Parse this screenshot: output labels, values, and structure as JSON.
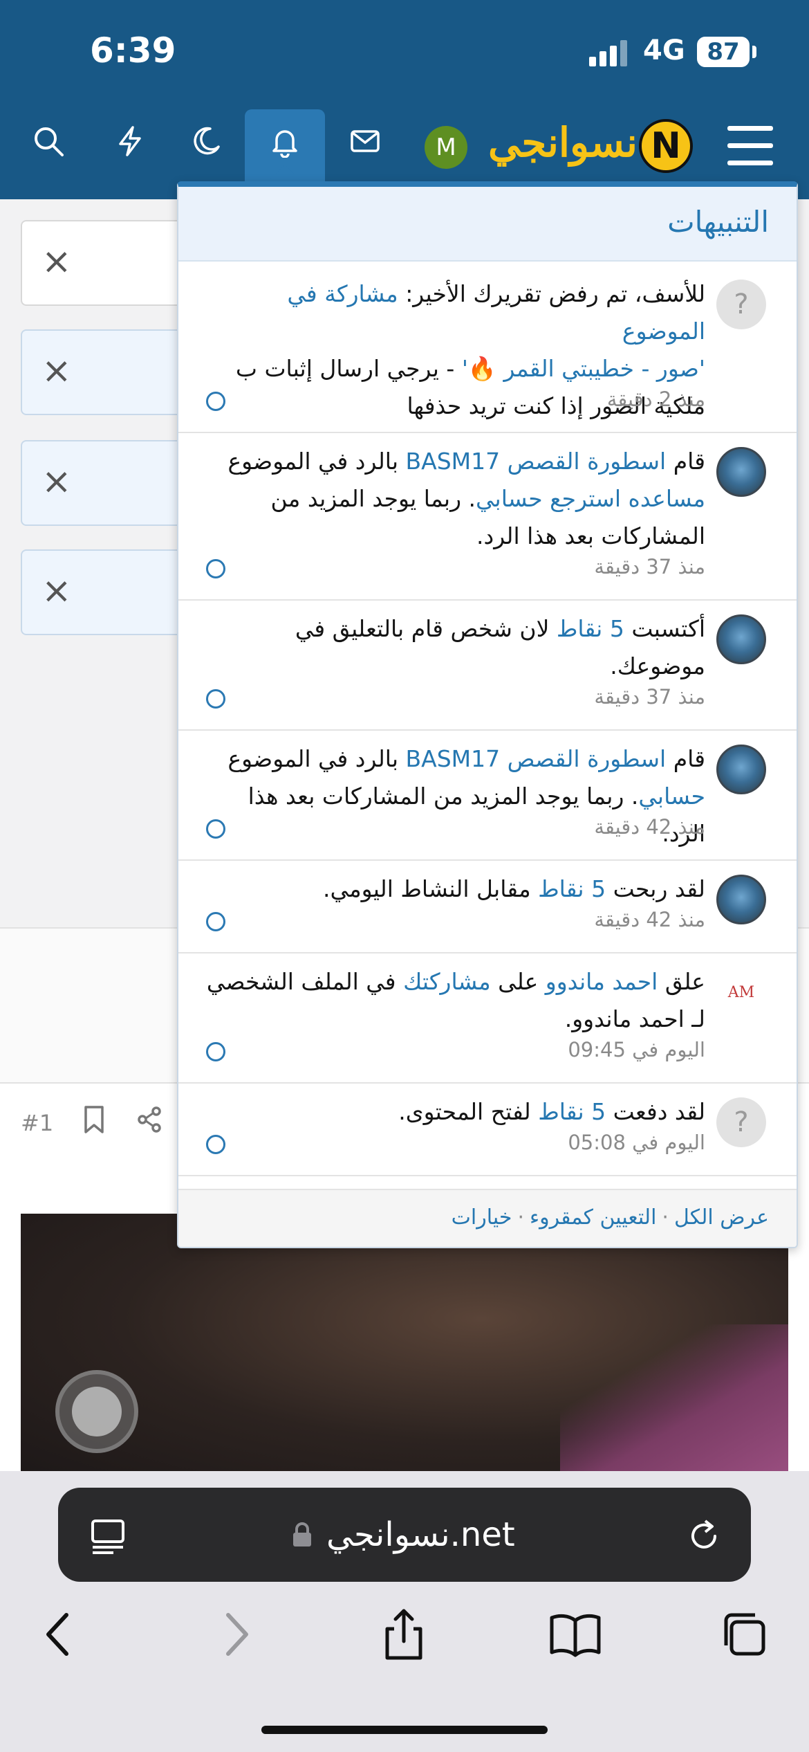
{
  "status_bar": {
    "time": "6:39",
    "network": "4G",
    "battery": "87"
  },
  "header": {
    "logo_text": "نسوانجي",
    "logo_letter": "N",
    "avatar_letter": "M",
    "icons": [
      "menu-icon",
      "bell-icon",
      "mail-icon",
      "moon-icon",
      "lightning-icon",
      "search-icon"
    ]
  },
  "notifications": {
    "title": "التنبيهات",
    "items": [
      {
        "avatar": "question-avatar",
        "lines": [
          {
            "parts": [
              {
                "t": "للأسف، تم رفض تقريرك الأخير: ",
                "link": false
              },
              {
                "t": "مشاركة في الموضوع",
                "link": true
              }
            ]
          },
          {
            "parts": [
              {
                "t": "'صور - خطيبتي القمر 🔥'",
                "link": true
              },
              {
                "t": " - يرجي ارسال إثبات ب",
                "link": false
              }
            ]
          },
          {
            "parts": [
              {
                "t": "ملكية الصور إذا كنت تريد حذفها",
                "link": false
              }
            ]
          }
        ],
        "time": "منذ 2 دقيقة"
      },
      {
        "avatar": "user-photo-avatar",
        "lines": [
          {
            "parts": [
              {
                "t": "قام ",
                "link": false
              },
              {
                "t": "اسطورة القصص BASM17",
                "link": true
              },
              {
                "t": " بالرد في الموضوع",
                "link": false
              }
            ]
          },
          {
            "parts": [
              {
                "t": "مساعده استرجع حسابي",
                "link": true
              },
              {
                "t": ". ربما يوجد المزيد من",
                "link": false
              }
            ]
          },
          {
            "parts": [
              {
                "t": "المشاركات بعد هذا الرد.",
                "link": false
              }
            ]
          }
        ],
        "time": "منذ 37 دقيقة"
      },
      {
        "avatar": "user-photo-avatar",
        "lines": [
          {
            "parts": [
              {
                "t": "أكتسبت ",
                "link": false
              },
              {
                "t": "5 نقاط",
                "link": true
              },
              {
                "t": " لان شخص قام بالتعليق في",
                "link": false
              }
            ]
          },
          {
            "parts": [
              {
                "t": "موضوعك.",
                "link": false
              }
            ]
          }
        ],
        "time": "منذ 37 دقيقة"
      },
      {
        "avatar": "user-photo-avatar",
        "lines": [
          {
            "parts": [
              {
                "t": "قام ",
                "link": false
              },
              {
                "t": "اسطورة القصص BASM17",
                "link": true
              },
              {
                "t": " بالرد في الموضوع",
                "link": false
              }
            ]
          },
          {
            "parts": [
              {
                "t": "حسابي",
                "link": true
              },
              {
                "t": ". ربما يوجد المزيد من المشاركات بعد هذا الرد.",
                "link": false
              }
            ]
          }
        ],
        "time": "منذ 42 دقيقة"
      },
      {
        "avatar": "user-photo-avatar",
        "lines": [
          {
            "parts": [
              {
                "t": "لقد ربحت ",
                "link": false
              },
              {
                "t": "5 نقاط",
                "link": true
              },
              {
                "t": " مقابل النشاط اليومي.",
                "link": false
              }
            ]
          }
        ],
        "time": "منذ 42 دقيقة"
      },
      {
        "avatar": "am-logo-avatar",
        "avatar_text": "AM",
        "lines": [
          {
            "parts": [
              {
                "t": "علق ",
                "link": false
              },
              {
                "t": "احمد ماندوو",
                "link": true
              },
              {
                "t": " على ",
                "link": false
              },
              {
                "t": "مشاركتك",
                "link": true
              },
              {
                "t": " في الملف الشخصي",
                "link": false
              }
            ]
          },
          {
            "parts": [
              {
                "t": "لـ احمد ماندوو.",
                "link": false
              }
            ]
          }
        ],
        "time": "اليوم في 09:45"
      },
      {
        "avatar": "question-avatar",
        "lines": [
          {
            "parts": [
              {
                "t": "لقد دفعت ",
                "link": false
              },
              {
                "t": "5 نقاط",
                "link": true
              },
              {
                "t": " لفتح المحتوى.",
                "link": false
              }
            ]
          }
        ],
        "time": "اليوم في 05:08"
      }
    ],
    "footer": {
      "view_all": "عرض الكل",
      "mark_read": "التعيين كمقروء",
      "options": "خيارات",
      "separator": "·"
    }
  },
  "page": {
    "post_number": "#1"
  },
  "browser": {
    "url": "نسوانجي.net"
  }
}
